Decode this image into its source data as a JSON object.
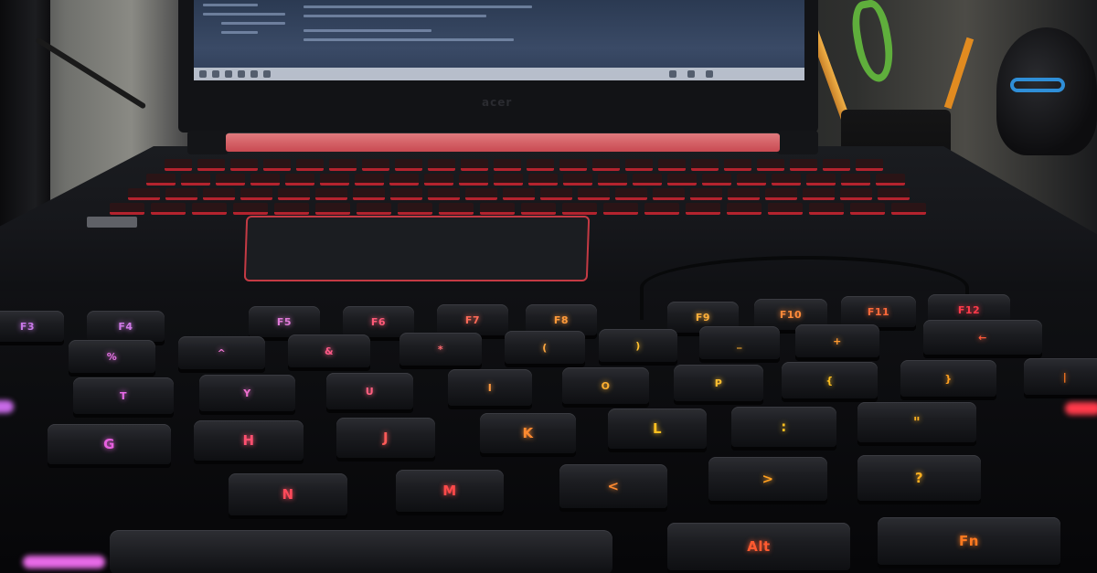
{
  "laptop": {
    "logo_text": "acer",
    "accent_color": "#c43a44"
  },
  "keyboard": {
    "backlight_colors": {
      "left": "#e05ce0",
      "center": "#ff4d5a",
      "right": "#ffb020"
    },
    "keys": [
      {
        "legend": "F3",
        "color": "#c878e8"
      },
      {
        "legend": "F4",
        "color": "#d07ae8"
      },
      {
        "legend": "F5",
        "color": "#e07ad8"
      },
      {
        "legend": "F6",
        "color": "#ff5a78"
      },
      {
        "legend": "F7",
        "color": "#ff6a58"
      },
      {
        "legend": "F8",
        "color": "#ff9a3a"
      },
      {
        "legend": "F9",
        "color": "#ffb03a"
      },
      {
        "legend": "F10",
        "color": "#ff8a3a"
      },
      {
        "legend": "F11",
        "color": "#ff6a3a"
      },
      {
        "legend": "F12",
        "color": "#ff3a4a"
      },
      {
        "legend": "%",
        "color": "#e070e0"
      },
      {
        "legend": "^",
        "color": "#ec74d0"
      },
      {
        "legend": "&",
        "color": "#ff5a88"
      },
      {
        "legend": "*",
        "color": "#ff6a70"
      },
      {
        "legend": "(",
        "color": "#ffa840"
      },
      {
        "legend": ")",
        "color": "#ffc030"
      },
      {
        "legend": "_",
        "color": "#ffb030"
      },
      {
        "legend": "+",
        "color": "#ff9a30"
      },
      {
        "legend": "←",
        "color": "#ff5a3a"
      },
      {
        "legend": "T",
        "color": "#e86ae8"
      },
      {
        "legend": "Y",
        "color": "#f070d0"
      },
      {
        "legend": "U",
        "color": "#ff6080"
      },
      {
        "legend": "I",
        "color": "#ff9a40"
      },
      {
        "legend": "O",
        "color": "#ffb030"
      },
      {
        "legend": "P",
        "color": "#ffc030"
      },
      {
        "legend": "{",
        "color": "#ffc020"
      },
      {
        "legend": "}",
        "color": "#ffa020"
      },
      {
        "legend": "|",
        "color": "#ff7a20"
      },
      {
        "legend": "G",
        "color": "#e860e0"
      },
      {
        "legend": "H",
        "color": "#ff5070"
      },
      {
        "legend": "J",
        "color": "#ff5a58"
      },
      {
        "legend": "K",
        "color": "#ff8a30"
      },
      {
        "legend": "L",
        "color": "#ffc020"
      },
      {
        "legend": ":",
        "color": "#ffc020"
      },
      {
        "legend": "\"",
        "color": "#ffb020"
      },
      {
        "legend": "N",
        "color": "#ff4a5a"
      },
      {
        "legend": "M",
        "color": "#ff4a4a"
      },
      {
        "legend": "<",
        "color": "#ff8a30"
      },
      {
        "legend": ">",
        "color": "#ffa020"
      },
      {
        "legend": "?",
        "color": "#ffb020"
      },
      {
        "legend": "Alt",
        "color": "#ff5a30"
      },
      {
        "legend": "Fn",
        "color": "#ff7a20"
      }
    ]
  }
}
